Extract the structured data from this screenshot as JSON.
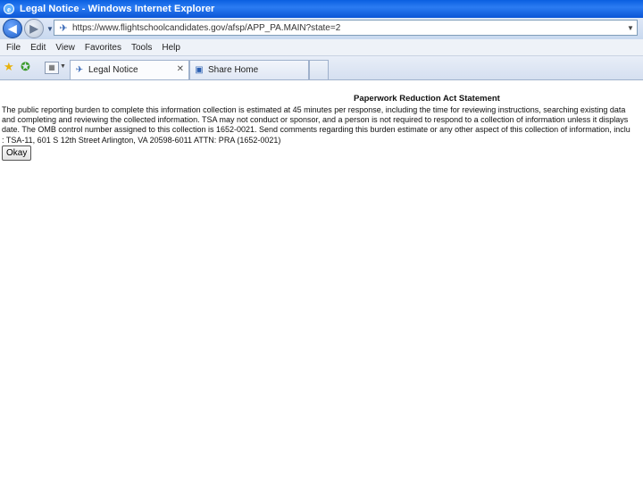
{
  "window": {
    "title": "Legal Notice - Windows Internet Explorer"
  },
  "address_bar": {
    "url": "https://www.flightschoolcandidates.gov/afsp/APP_PA.MAIN?state=2"
  },
  "menu": {
    "items": [
      "File",
      "Edit",
      "View",
      "Favorites",
      "Tools",
      "Help"
    ]
  },
  "tabs": [
    {
      "label": "Legal Notice"
    },
    {
      "label": "Share Home"
    }
  ],
  "content": {
    "heading": "Paperwork Reduction Act Statement",
    "lines": [
      "The public reporting burden to complete this information collection is estimated at 45 minutes per response, including the time for reviewing instructions, searching existing data",
      "and completing and reviewing the collected information. TSA may not conduct or sponsor, and a person is not required to respond to a collection of information unless it displays",
      "date. The OMB control number assigned to this collection is 1652-0021. Send comments regarding this burden estimate or any other aspect of this collection of information, inclu",
      ": TSA-11, 601 S 12th Street Arlington, VA 20598-6011 ATTN: PRA (1652-0021)"
    ],
    "okay_label": "Okay"
  },
  "colors": {
    "titlebar": "#0a5fe0",
    "content_bg": "#ffffff"
  }
}
